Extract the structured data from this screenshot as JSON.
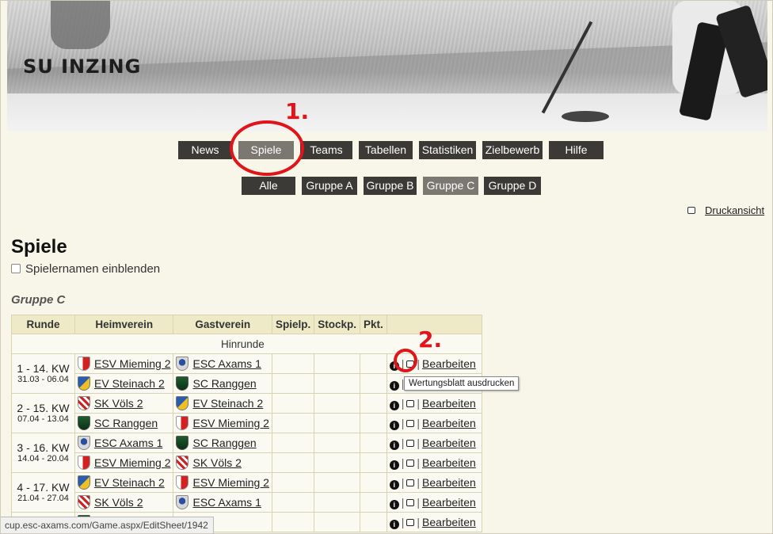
{
  "banner": {
    "site_title": "SU INZING"
  },
  "nav": {
    "items": [
      {
        "label": "News"
      },
      {
        "label": "Spiele"
      },
      {
        "label": "Teams"
      },
      {
        "label": "Tabellen"
      },
      {
        "label": "Statistiken"
      },
      {
        "label": "Zielbewerb"
      },
      {
        "label": "Hilfe"
      }
    ],
    "active": "Spiele"
  },
  "subnav": {
    "items": [
      {
        "label": "Alle"
      },
      {
        "label": "Gruppe A"
      },
      {
        "label": "Gruppe B"
      },
      {
        "label": "Gruppe C"
      },
      {
        "label": "Gruppe D"
      }
    ],
    "active": "Gruppe C"
  },
  "annotations": {
    "step1": "1.",
    "step2": "2."
  },
  "print_view": {
    "label": "Druckansicht",
    "icon": "printer-icon"
  },
  "page": {
    "title": "Spiele",
    "show_player_names_label": "Spielernamen einblenden",
    "show_player_names_checked": false,
    "group_title": "Gruppe C"
  },
  "table": {
    "headers": [
      "Runde",
      "Heimverein",
      "Gastverein",
      "Spielp.",
      "Stockp.",
      "Pkt.",
      ""
    ],
    "section_label": "Hinrunde",
    "rounds": [
      {
        "round": "1 - 14. KW",
        "dates": "31.03 - 06.04",
        "games": [
          {
            "home": "ESV Mieming 2",
            "home_logo": "red",
            "away": "ESC Axams 1",
            "away_logo": "crest"
          },
          {
            "home": "EV Steinach 2",
            "home_logo": "blue",
            "away": "SC Ranggen",
            "away_logo": "green"
          }
        ]
      },
      {
        "round": "2 - 15. KW",
        "dates": "07.04 - 13.04",
        "games": [
          {
            "home": "SK Völs 2",
            "home_logo": "white",
            "away": "EV Steinach 2",
            "away_logo": "blue"
          },
          {
            "home": "SC Ranggen",
            "home_logo": "green",
            "away": "ESV Mieming 2",
            "away_logo": "red"
          }
        ]
      },
      {
        "round": "3 - 16. KW",
        "dates": "14.04 - 20.04",
        "games": [
          {
            "home": "ESC Axams 1",
            "home_logo": "crest",
            "away": "SC Ranggen",
            "away_logo": "green"
          },
          {
            "home": "ESV Mieming 2",
            "home_logo": "red",
            "away": "SK Völs 2",
            "away_logo": "white"
          }
        ]
      },
      {
        "round": "4 - 17. KW",
        "dates": "21.04 - 27.04",
        "games": [
          {
            "home": "EV Steinach 2",
            "home_logo": "blue",
            "away": "ESV Mieming 2",
            "away_logo": "red"
          },
          {
            "home": "SK Völs 2",
            "home_logo": "white",
            "away": "ESC Axams 1",
            "away_logo": "crest"
          }
        ]
      },
      {
        "round": "",
        "dates": "",
        "games": [
          {
            "home": "",
            "home_logo": "green",
            "away": "",
            "away_logo": "",
            "partial": true
          }
        ]
      }
    ],
    "action_info_icon": "info-icon",
    "action_print_icon": "printer-icon",
    "action_separator": "|",
    "edit_label": "Bearbeiten"
  },
  "tooltip": {
    "text": "Wertungsblatt ausdrucken"
  },
  "status_bar": {
    "url": "cup.esc-axams.com/Game.aspx/EditSheet/1942"
  },
  "colors": {
    "nav_bg": "#3c3a36",
    "nav_active": "#7b7872",
    "annotation_red": "#e0151a",
    "table_header": "#eeeac8",
    "page_bg": "#f8f5e9"
  }
}
